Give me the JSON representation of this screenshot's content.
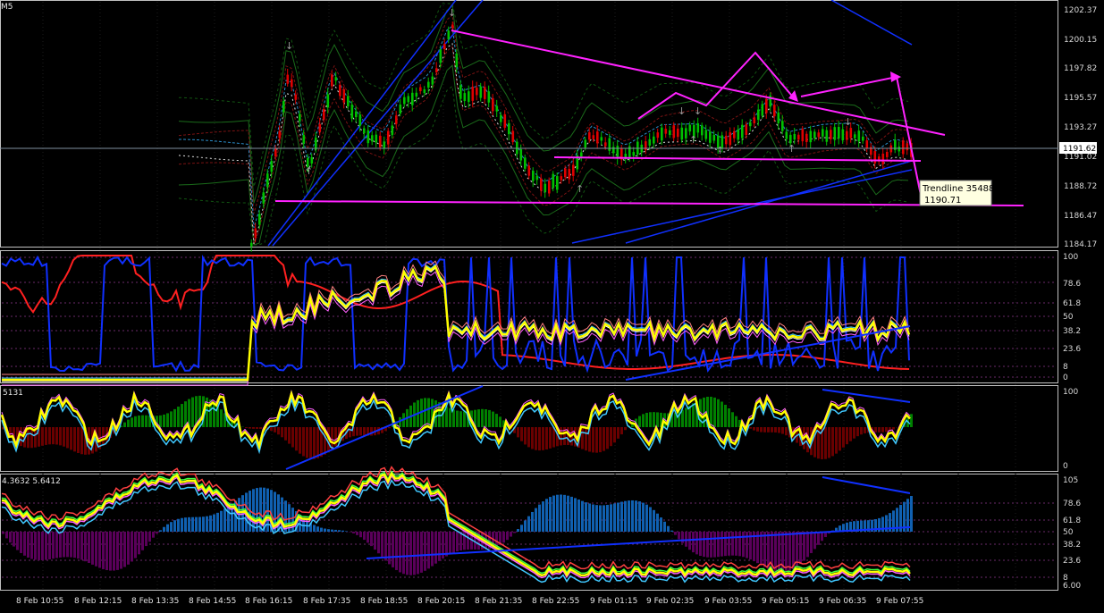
{
  "window": {
    "symbol_period": "M5"
  },
  "main_panel": {
    "price_labels": [
      "1202.37",
      "1200.15",
      "1197.82",
      "1195.57",
      "1193.27",
      "1191.02",
      "1188.72",
      "1186.47",
      "1184.17"
    ],
    "current_price": "1191.62"
  },
  "tooltip": {
    "line1": "Trendline 35488",
    "line2": "1190.71"
  },
  "osc1": {
    "levels": [
      "100",
      "78.6",
      "61.8",
      "50",
      "38.2",
      "23.6",
      "8",
      "0"
    ]
  },
  "osc2": {
    "value_label": "5131",
    "levels": [
      "100",
      "0"
    ]
  },
  "osc3": {
    "value_label": "4.3632 5.6412",
    "levels": [
      "105",
      "78.6",
      "61.8",
      "50",
      "38.2",
      "23.6",
      "8",
      "6.00"
    ]
  },
  "time_axis": [
    "8 Feb 10:55",
    "8 Feb 12:15",
    "8 Feb 13:35",
    "8 Feb 14:55",
    "8 Feb 16:15",
    "8 Feb 17:35",
    "8 Feb 18:55",
    "8 Feb 20:15",
    "8 Feb 21:35",
    "8 Feb 22:55",
    "9 Feb 01:15",
    "9 Feb 02:35",
    "9 Feb 03:55",
    "9 Feb 05:15",
    "9 Feb 06:35",
    "9 Feb 07:55"
  ],
  "colors": {
    "background": "#000000",
    "axis": "#c0c0c0",
    "bull": "#00c000",
    "bear": "#e00000",
    "trendline": "#ff22ff",
    "yellow": "#ffff00",
    "blue": "#1030ff",
    "red": "#ff2020",
    "cyan": "#40c8ff",
    "green_hist": "#008000",
    "darkred_hist": "#6a0000",
    "blue_hist": "#1060b0",
    "purple_hist": "#5a005a"
  }
}
